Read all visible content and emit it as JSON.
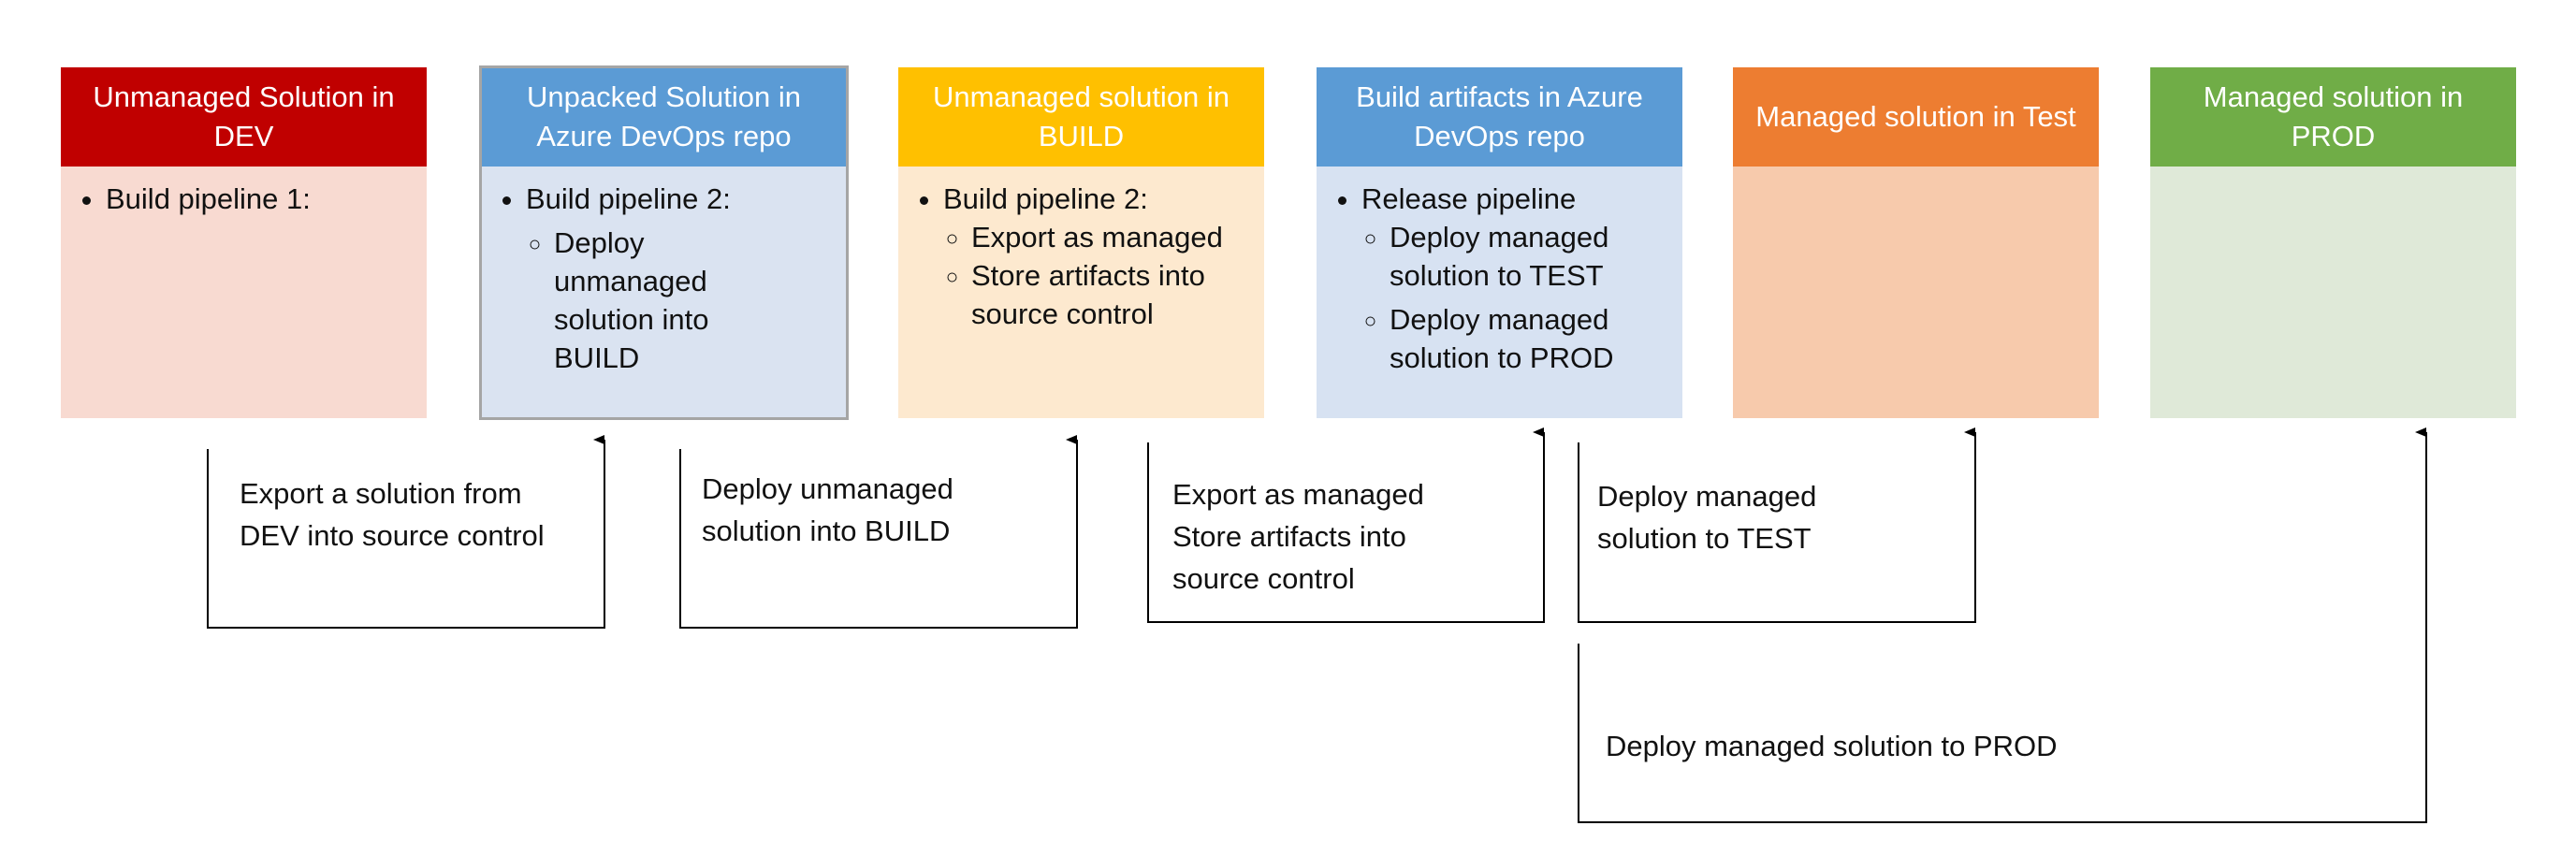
{
  "stages": [
    {
      "title": "Unmanaged Solution in DEV",
      "header_color": "#c00000",
      "body_color": "#f8dad1",
      "items": [
        "Build pipeline 1:"
      ],
      "subitems": []
    },
    {
      "title": "Unpacked Solution in Azure DevOps repo",
      "header_color": "#5b9bd5",
      "body_color": "#dae3f1",
      "items": [
        "Build pipeline 2:"
      ],
      "subitems": [
        "Deploy unmanaged solution into BUILD"
      ]
    },
    {
      "title": "Unmanaged solution in BUILD",
      "header_color": "#ffc000",
      "body_color": "#fde9cf",
      "items": [
        "Build pipeline 2:"
      ],
      "subitems": [
        "Export as managed",
        "Store artifacts into source control"
      ]
    },
    {
      "title": "Build artifacts in Azure DevOps repo",
      "header_color": "#5b9bd5",
      "body_color": "#d7e2f2",
      "items": [
        "Release pipeline"
      ],
      "subitems": [
        "Deploy managed solution to TEST",
        "Deploy managed solution to PROD"
      ]
    },
    {
      "title": "Managed solution in Test",
      "header_color": "#ed7d31",
      "body_color": "#f7caac",
      "items": [],
      "subitems": []
    },
    {
      "title": "Managed solution in PROD",
      "header_color": "#70ad47",
      "body_color": "#dfe9d8",
      "items": [],
      "subitems": []
    }
  ],
  "transitions": [
    {
      "label_lines": [
        "Export a solution from",
        "DEV into source control"
      ]
    },
    {
      "label_lines": [
        "Deploy unmanaged",
        "solution into BUILD"
      ]
    },
    {
      "label_lines": [
        "Export as managed",
        "Store artifacts into",
        "source control"
      ]
    },
    {
      "label_lines": [
        "Deploy managed",
        "solution to TEST"
      ]
    },
    {
      "label_lines": [
        "Deploy managed solution to PROD"
      ]
    }
  ]
}
